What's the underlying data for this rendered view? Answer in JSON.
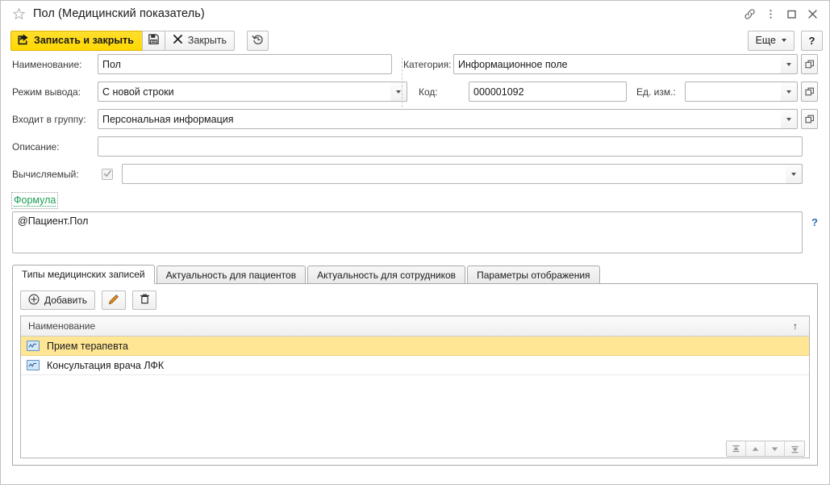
{
  "window": {
    "title": "Пол (Медицинский показатель)",
    "icons": {
      "favorite": "star-icon",
      "link": "link-icon",
      "menu": "vertical-ellipsis-icon",
      "maximize": "maximize-icon",
      "close": "close-icon"
    }
  },
  "commandbar": {
    "save_and_close": "Записать и закрыть",
    "save": "",
    "close": "Закрыть",
    "history": "",
    "more": "Еще",
    "help": "?"
  },
  "form": {
    "name_label": "Наименование:",
    "name_value": "Пол",
    "category_label": "Категория:",
    "category_value": "Информационное поле",
    "output_mode_label": "Режим вывода:",
    "output_mode_value": "С новой строки",
    "code_label": "Код:",
    "code_value": "000001092",
    "unit_label": "Ед. изм.:",
    "unit_value": "",
    "group_label": "Входит в группу:",
    "group_value": "Персональная информация",
    "description_label": "Описание:",
    "description_value": "",
    "calculated_label": "Вычисляемый:",
    "calculated_checked": true,
    "calculated_value": "",
    "formula_link": "Формула",
    "formula_value": "@Пациент.Пол",
    "formula_help": "?"
  },
  "tabs": [
    {
      "label": "Типы медицинских записей",
      "active": true
    },
    {
      "label": "Актуальность для пациентов",
      "active": false
    },
    {
      "label": "Актуальность для сотрудников",
      "active": false
    },
    {
      "label": "Параметры отображения",
      "active": false
    }
  ],
  "grid_toolbar": {
    "add": "Добавить",
    "edit": "",
    "delete": ""
  },
  "grid": {
    "columns": [
      "Наименование"
    ],
    "sort_indicator": "↑",
    "rows": [
      {
        "name": "Прием терапевта",
        "selected": true
      },
      {
        "name": "Консультация врача ЛФК",
        "selected": false
      }
    ]
  },
  "colors": {
    "accent_yellow": "#ffd800",
    "selected_row": "#ffe695",
    "link_green": "#1a9e55",
    "help_blue": "#2b6cb0"
  }
}
